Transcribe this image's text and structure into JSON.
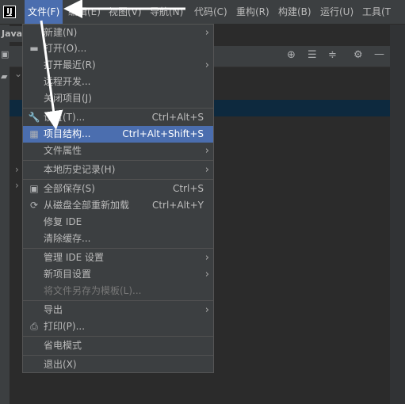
{
  "app": {
    "logo_text": "IJ",
    "tool_window_tab": "Java"
  },
  "menubar": {
    "items": [
      "文件(F)",
      "编辑(E)",
      "视图(V)",
      "导航(N)",
      "代码(C)",
      "重构(R)",
      "构建(B)",
      "运行(U)",
      "工具(T"
    ],
    "active_index": 0
  },
  "file_menu": {
    "items": [
      {
        "label": "新建(N)",
        "submenu": true
      },
      {
        "label": "打开(O)...",
        "icon": "folder-icon"
      },
      {
        "label": "打开最近(R)",
        "submenu": true
      },
      {
        "label": "远程开发..."
      },
      {
        "label": "关闭项目(J)"
      },
      {
        "label": "设置(T)...",
        "icon": "wrench-icon",
        "shortcut": "Ctrl+Alt+S"
      },
      {
        "label": "项目结构...",
        "icon": "project-structure-icon",
        "shortcut": "Ctrl+Alt+Shift+S",
        "highlighted": true
      },
      {
        "label": "文件属性",
        "submenu": true
      },
      {
        "label": "本地历史记录(H)",
        "submenu": true
      },
      {
        "label": "全部保存(S)",
        "icon": "save-icon",
        "shortcut": "Ctrl+S"
      },
      {
        "label": "从磁盘全部重新加载",
        "icon": "reload-icon",
        "shortcut": "Ctrl+Alt+Y"
      },
      {
        "label": "修复 IDE"
      },
      {
        "label": "清除缓存..."
      },
      {
        "label": "管理 IDE 设置",
        "submenu": true
      },
      {
        "label": "新项目设置",
        "submenu": true
      },
      {
        "label": "将文件另存为模板(L)...",
        "disabled": true
      },
      {
        "label": "导出",
        "submenu": true
      },
      {
        "label": "打印(P)...",
        "icon": "print-icon"
      },
      {
        "label": "省电模式"
      },
      {
        "label": "退出(X)"
      }
    ]
  },
  "colors": {
    "highlight": "#4b6eaf",
    "menu_bg": "#3c3f41",
    "editor_bg": "#2b2b2b",
    "annotation": "#ffffff"
  }
}
